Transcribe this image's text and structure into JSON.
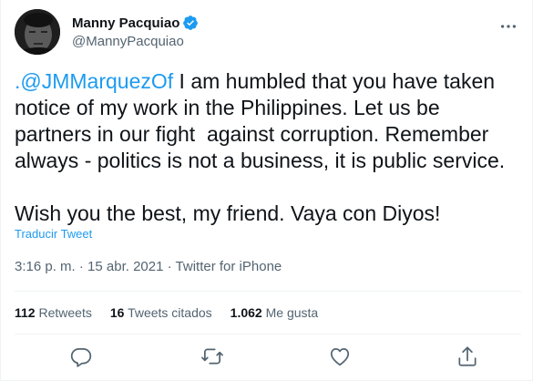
{
  "user": {
    "display_name": "Manny Pacquiao",
    "handle": "@MannyPacquiao",
    "verified": true,
    "verified_color": "#1d9bf0"
  },
  "tweet": {
    "mention": ".@JMMarquezOf",
    "text_after_mention": " I am humbled that you have taken notice of my work in the Philippines. Let us be partners in our fight  against corruption. Remember always - politics is not a business, it is public service.",
    "paragraph2": "Wish you the best, my friend. Vaya con Diyos!",
    "translate_label": "Traducir Tweet"
  },
  "meta": {
    "time": "3:16 p. m.",
    "separator": " · ",
    "date": "15 abr. 2021",
    "source": "Twitter for iPhone"
  },
  "stats": {
    "retweets_count": "112",
    "retweets_label": "Retweets",
    "quotes_count": "16",
    "quotes_label": "Tweets citados",
    "likes_count": "1.062",
    "likes_label": "Me gusta"
  },
  "icons": {
    "verified": "verified-badge-icon",
    "more": "more-icon",
    "reply": "reply-icon",
    "retweet": "retweet-icon",
    "like": "like-icon",
    "share": "share-icon"
  },
  "colors": {
    "link": "#1d9bf0",
    "text": "#0f1419",
    "secondary": "#536471",
    "divider": "#eff3f4"
  }
}
